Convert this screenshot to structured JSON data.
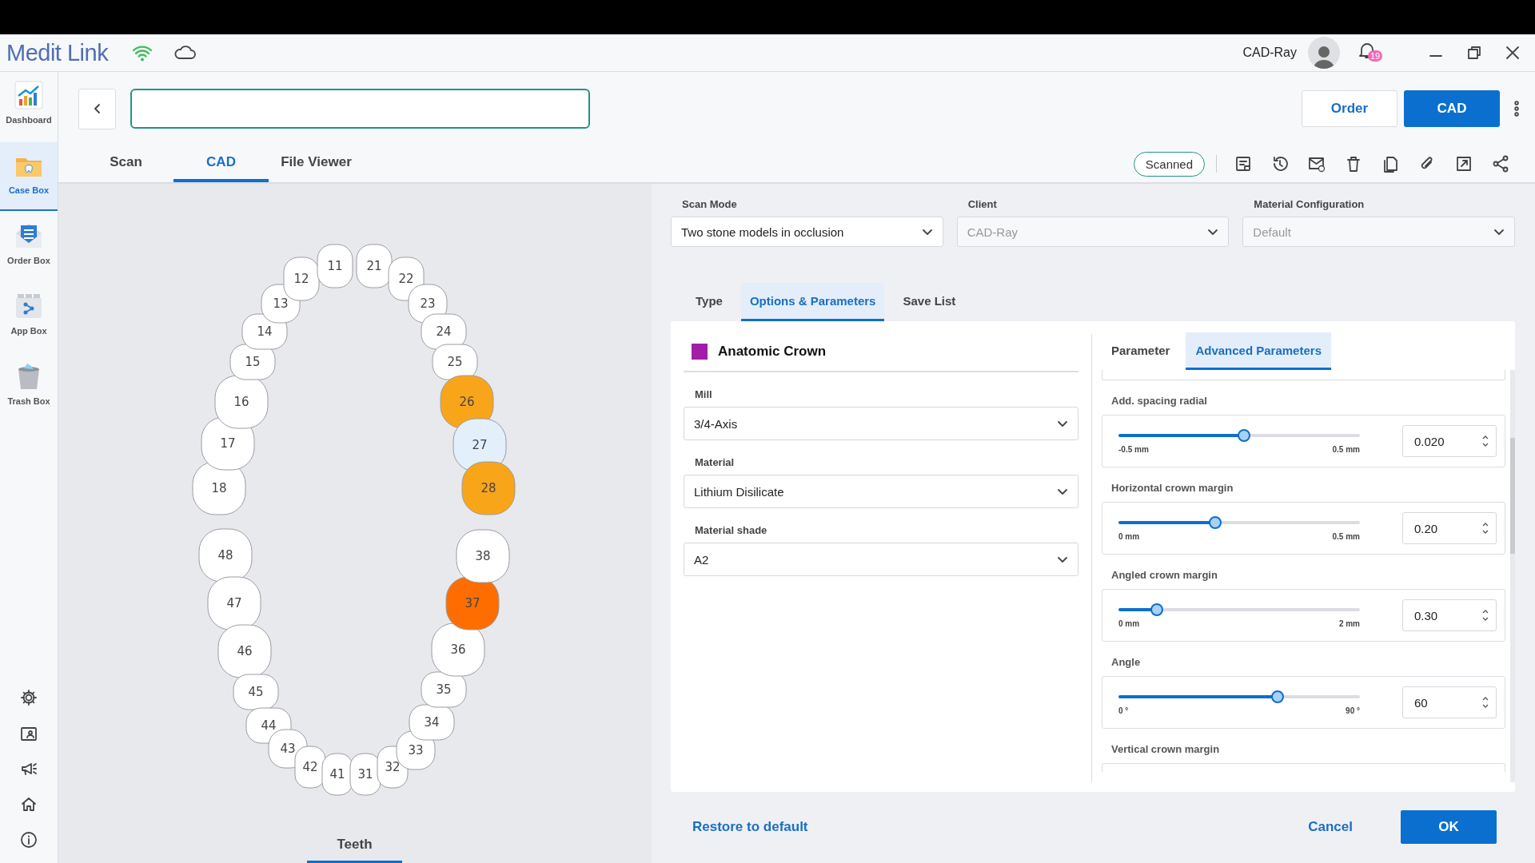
{
  "title_bar": {
    "logo": "Medit Link",
    "user": "CAD-Ray",
    "notification_count": "19"
  },
  "sidebar": {
    "items": [
      {
        "label": "Dashboard",
        "selected": false
      },
      {
        "label": "Case Box",
        "selected": true
      },
      {
        "label": "Order Box",
        "selected": false
      },
      {
        "label": "App Box",
        "selected": false
      },
      {
        "label": "Trash Box",
        "selected": false
      }
    ]
  },
  "header_buttons": [
    {
      "label": "Order",
      "kind": "outline"
    },
    {
      "label": "CAD",
      "kind": "primary"
    }
  ],
  "tabs": [
    {
      "label": "Scan",
      "selected": false
    },
    {
      "label": "CAD",
      "selected": true
    },
    {
      "label": "File Viewer",
      "selected": false
    }
  ],
  "status_badge": "Scanned",
  "teeth": {
    "label": "Teeth",
    "items": [
      {
        "number": "18",
        "kind": "molar",
        "color": "#ffffff"
      },
      {
        "number": "17",
        "kind": "molar",
        "color": "#ffffff"
      },
      {
        "number": "16",
        "kind": "molar",
        "color": "#ffffff"
      },
      {
        "number": "15",
        "kind": "premolar",
        "color": "#ffffff"
      },
      {
        "number": "14",
        "kind": "premolar",
        "color": "#ffffff"
      },
      {
        "number": "13",
        "kind": "canine",
        "color": "#ffffff"
      },
      {
        "number": "12",
        "kind": "incisor",
        "color": "#ffffff"
      },
      {
        "number": "11",
        "kind": "incisor",
        "color": "#ffffff"
      },
      {
        "number": "21",
        "kind": "incisor",
        "color": "#ffffff"
      },
      {
        "number": "22",
        "kind": "incisor",
        "color": "#ffffff"
      },
      {
        "number": "23",
        "kind": "canine",
        "color": "#ffffff"
      },
      {
        "number": "24",
        "kind": "premolar",
        "color": "#ffffff"
      },
      {
        "number": "25",
        "kind": "premolar",
        "color": "#ffffff"
      },
      {
        "number": "26",
        "kind": "molar",
        "color": "#f9a51a"
      },
      {
        "number": "27",
        "kind": "molar",
        "color": "#e3effb"
      },
      {
        "number": "28",
        "kind": "molar",
        "color": "#f9a51a"
      },
      {
        "number": "48",
        "kind": "molar",
        "color": "#ffffff"
      },
      {
        "number": "47",
        "kind": "molar",
        "color": "#ffffff"
      },
      {
        "number": "46",
        "kind": "molar",
        "color": "#ffffff"
      },
      {
        "number": "45",
        "kind": "premolar",
        "color": "#ffffff"
      },
      {
        "number": "44",
        "kind": "premolar",
        "color": "#ffffff"
      },
      {
        "number": "43",
        "kind": "canine",
        "color": "#ffffff"
      },
      {
        "number": "42",
        "kind": "incisor",
        "color": "#ffffff"
      },
      {
        "number": "41",
        "kind": "incisor",
        "color": "#ffffff"
      },
      {
        "number": "31",
        "kind": "incisor",
        "color": "#ffffff"
      },
      {
        "number": "32",
        "kind": "incisor",
        "color": "#ffffff"
      },
      {
        "number": "33",
        "kind": "canine",
        "color": "#ffffff"
      },
      {
        "number": "34",
        "kind": "premolar",
        "color": "#ffffff"
      },
      {
        "number": "35",
        "kind": "premolar",
        "color": "#ffffff"
      },
      {
        "number": "36",
        "kind": "molar",
        "color": "#ffffff"
      },
      {
        "number": "37",
        "kind": "molar",
        "color": "#ff6d00"
      },
      {
        "number": "38",
        "kind": "molar",
        "color": "#ffffff"
      }
    ]
  },
  "case_fields": [
    {
      "label": "Scan Mode",
      "value": "Two stone models in occlusion",
      "disabled": false
    },
    {
      "label": "Client",
      "value": "CAD-Ray",
      "disabled": true
    },
    {
      "label": "Material Configuration",
      "value": "Default",
      "disabled": true
    }
  ],
  "section_tabs": [
    {
      "label": "Type",
      "selected": false
    },
    {
      "label": "Options & Parameters",
      "selected": true
    },
    {
      "label": "Save List",
      "selected": false
    }
  ],
  "restoration": {
    "name": "Anatomic Crown",
    "color": "#a01ea8",
    "fields": [
      {
        "label": "Mill",
        "value": "3/4-Axis"
      },
      {
        "label": "Material",
        "value": "Lithium Disilicate"
      },
      {
        "label": "Material shade",
        "value": "A2"
      }
    ]
  },
  "parameter_tabs": [
    {
      "label": "Parameter",
      "selected": false
    },
    {
      "label": "Advanced Parameters",
      "selected": true
    }
  ],
  "parameters": [
    {
      "label": "Add. spacing radial",
      "level": 0.52,
      "min": "-0.5 mm",
      "max": "0.5 mm",
      "value": "0.020"
    },
    {
      "label": "Horizontal crown margin",
      "level": 0.4,
      "min": "0 mm",
      "max": "0.5 mm",
      "value": "0.20"
    },
    {
      "label": "Angled crown margin",
      "level": 0.16,
      "min": "0 mm",
      "max": "2 mm",
      "value": "0.30"
    },
    {
      "label": "Angle",
      "level": 0.66,
      "min": "0 °",
      "max": "90 °",
      "value": "60"
    }
  ],
  "next_parameter_label": "Vertical crown margin",
  "footer": {
    "restore": "Restore to default",
    "cancel": "Cancel",
    "ok": "OK"
  }
}
